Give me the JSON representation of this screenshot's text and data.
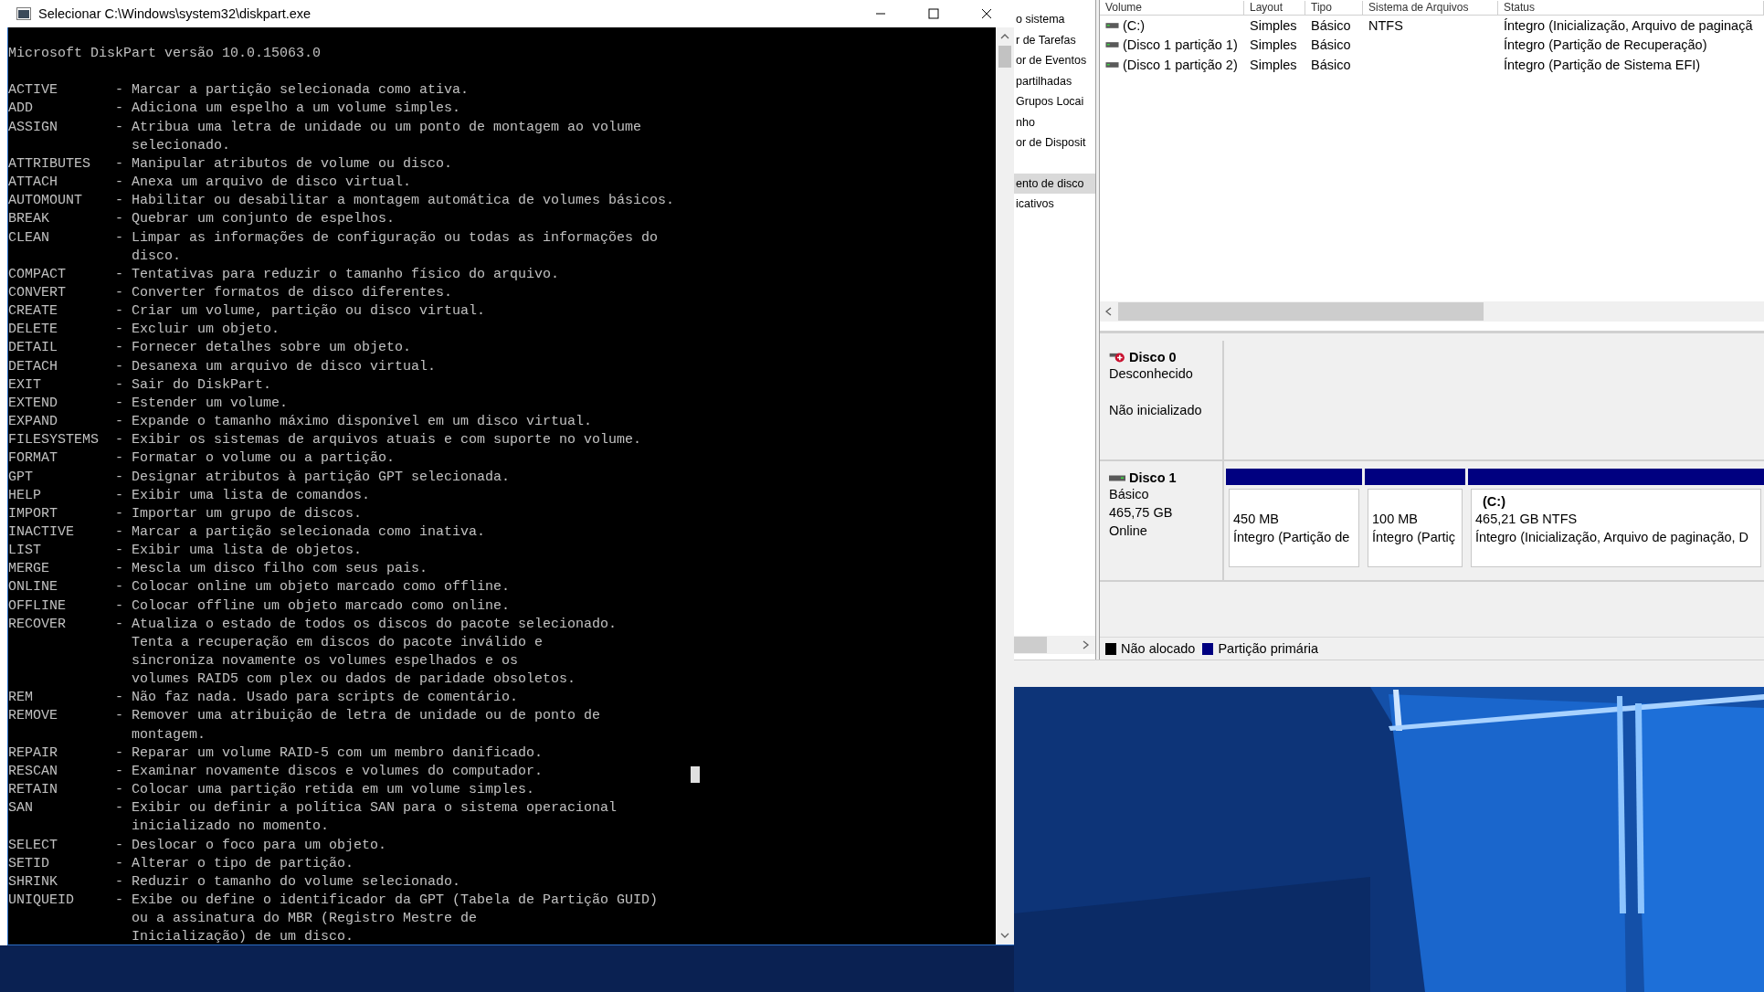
{
  "console": {
    "title": "Selecionar C:\\Windows\\system32\\diskpart.exe",
    "header": "Microsoft DiskPart versão 10.0.15063.0",
    "commands": [
      {
        "name": "ACTIVE",
        "lines": [
          "- Marcar a partição selecionada como ativa."
        ],
        "cursor": false
      },
      {
        "name": "ADD",
        "lines": [
          "- Adiciona um espelho a um volume simples."
        ],
        "cursor": false
      },
      {
        "name": "ASSIGN",
        "lines": [
          "- Atribua uma letra de unidade ou um ponto de montagem ao volume",
          "selecionado."
        ],
        "cursor": false
      },
      {
        "name": "ATTRIBUTES",
        "lines": [
          "- Manipular atributos de volume ou disco."
        ],
        "cursor": false
      },
      {
        "name": "ATTACH",
        "lines": [
          "- Anexa um arquivo de disco virtual."
        ],
        "cursor": false
      },
      {
        "name": "AUTOMOUNT",
        "lines": [
          "- Habilitar ou desabilitar a montagem automática de volumes básicos."
        ],
        "cursor": false
      },
      {
        "name": "BREAK",
        "lines": [
          "- Quebrar um conjunto de espelhos."
        ],
        "cursor": false
      },
      {
        "name": "CLEAN",
        "lines": [
          "- Limpar as informações de configuração ou todas as informações do",
          "disco."
        ],
        "cursor": false
      },
      {
        "name": "COMPACT",
        "lines": [
          "- Tentativas para reduzir o tamanho físico do arquivo."
        ],
        "cursor": false
      },
      {
        "name": "CONVERT",
        "lines": [
          "- Converter formatos de disco diferentes."
        ],
        "cursor": false
      },
      {
        "name": "CREATE",
        "lines": [
          "- Criar um volume, partição ou disco virtual."
        ],
        "cursor": false
      },
      {
        "name": "DELETE",
        "lines": [
          "- Excluir um objeto."
        ],
        "cursor": false
      },
      {
        "name": "DETAIL",
        "lines": [
          "- Fornecer detalhes sobre um objeto."
        ],
        "cursor": false
      },
      {
        "name": "DETACH",
        "lines": [
          "- Desanexa um arquivo de disco virtual."
        ],
        "cursor": false
      },
      {
        "name": "EXIT",
        "lines": [
          "- Sair do DiskPart."
        ],
        "cursor": false
      },
      {
        "name": "EXTEND",
        "lines": [
          "- Estender um volume."
        ],
        "cursor": false
      },
      {
        "name": "EXPAND",
        "lines": [
          "- Expande o tamanho máximo disponível em um disco virtual."
        ],
        "cursor": false
      },
      {
        "name": "FILESYSTEMS",
        "lines": [
          "- Exibir os sistemas de arquivos atuais e com suporte no volume."
        ],
        "cursor": false
      },
      {
        "name": "FORMAT",
        "lines": [
          "- Formatar o volume ou a partição."
        ],
        "cursor": false
      },
      {
        "name": "GPT",
        "lines": [
          "- Designar atributos à partição GPT selecionada."
        ],
        "cursor": false
      },
      {
        "name": "HELP",
        "lines": [
          "- Exibir uma lista de comandos."
        ],
        "cursor": false
      },
      {
        "name": "IMPORT",
        "lines": [
          "- Importar um grupo de discos."
        ],
        "cursor": false
      },
      {
        "name": "INACTIVE",
        "lines": [
          "- Marcar a partição selecionada como inativa."
        ],
        "cursor": false
      },
      {
        "name": "LIST",
        "lines": [
          "- Exibir uma lista de objetos."
        ],
        "cursor": false
      },
      {
        "name": "MERGE",
        "lines": [
          "- Mescla um disco filho com seus pais."
        ],
        "cursor": false
      },
      {
        "name": "ONLINE",
        "lines": [
          "- Colocar online um objeto marcado como offline."
        ],
        "cursor": false
      },
      {
        "name": "OFFLINE",
        "lines": [
          "- Colocar offline um objeto marcado como online."
        ],
        "cursor": false
      },
      {
        "name": "RECOVER",
        "lines": [
          "- Atualiza o estado de todos os discos do pacote selecionado.",
          "Tenta a recuperação em discos do pacote inválido e",
          "sincroniza novamente os volumes espelhados e os",
          "volumes RAID5 com plex ou dados de paridade obsoletos."
        ],
        "cursor": false
      },
      {
        "name": "REM",
        "lines": [
          "- Não faz nada. Usado para scripts de comentário."
        ],
        "cursor": false
      },
      {
        "name": "REMOVE",
        "lines": [
          "- Remover uma atribuição de letra de unidade ou de ponto de",
          "montagem."
        ],
        "cursor": false
      },
      {
        "name": "REPAIR",
        "lines": [
          "- Reparar um volume RAID-5 com um membro danificado."
        ],
        "cursor": false
      },
      {
        "name": "RESCAN",
        "lines": [
          "- Examinar novamente discos e volumes do computador."
        ],
        "cursor": true
      },
      {
        "name": "RETAIN",
        "lines": [
          "- Colocar uma partição retida em um volume simples."
        ],
        "cursor": false
      },
      {
        "name": "SAN",
        "lines": [
          "- Exibir ou definir a política SAN para o sistema operacional",
          "inicializado no momento."
        ],
        "cursor": false
      },
      {
        "name": "SELECT",
        "lines": [
          "- Deslocar o foco para um objeto."
        ],
        "cursor": false
      },
      {
        "name": "SETID",
        "lines": [
          "- Alterar o tipo de partição."
        ],
        "cursor": false
      },
      {
        "name": "SHRINK",
        "lines": [
          "- Reduzir o tamanho do volume selecionado."
        ],
        "cursor": false
      },
      {
        "name": "UNIQUEID",
        "lines": [
          "- Exibe ou define o identificador da GPT (Tabela de Partição GUID)",
          "ou a assinatura do MBR (Registro Mestre de",
          "Inicialização) de um disco."
        ],
        "cursor": false
      }
    ]
  },
  "management": {
    "nav": {
      "items": [
        {
          "label": "o sistema",
          "selected": false
        },
        {
          "label": "r de Tarefas",
          "selected": false
        },
        {
          "label": "or de Eventos",
          "selected": false
        },
        {
          "label": "partilhadas",
          "selected": false
        },
        {
          "label": "Grupos Locai",
          "selected": false
        },
        {
          "label": "nho",
          "selected": false
        },
        {
          "label": "or de Disposit",
          "selected": false
        },
        {
          "label": "ento de disco",
          "selected": true
        },
        {
          "label": "icativos",
          "selected": false
        }
      ]
    },
    "volumes": {
      "columns": [
        "Volume",
        "Layout",
        "Tipo",
        "Sistema de Arquivos",
        "Status"
      ],
      "rows": [
        {
          "cells": [
            "(C:)",
            "Simples",
            "Básico",
            "NTFS",
            "Íntegro (Inicialização, Arquivo de paginaçã"
          ]
        },
        {
          "cells": [
            "(Disco 1 partição 1)",
            "Simples",
            "Básico",
            "",
            "Íntegro (Partição de Recuperação)"
          ]
        },
        {
          "cells": [
            "(Disco 1 partição 2)",
            "Simples",
            "Básico",
            "",
            "Íntegro (Partição de Sistema EFI)"
          ]
        }
      ]
    },
    "disks": [
      {
        "name": "Disco 0",
        "kind": "error",
        "info": [
          "Desconhecido"
        ],
        "status": "Não inicializado"
      },
      {
        "name": "Disco 1",
        "kind": "basic",
        "info": [
          "Básico",
          "465,75 GB",
          "Online"
        ],
        "partitions": [
          {
            "size": "450 MB",
            "status": "Íntegro (Partição de",
            "color": "#000080"
          },
          {
            "size": "100 MB",
            "status": "Íntegro (Partiç",
            "color": "#000080"
          },
          {
            "label": "(C:)",
            "size": "465,21 GB NTFS",
            "status": "Íntegro (Inicialização, Arquivo de paginação, D",
            "color": "#000080"
          }
        ]
      }
    ],
    "legend": [
      {
        "label": "Não alocado",
        "color": "#000000"
      },
      {
        "label": "Partição primária",
        "color": "#000080"
      }
    ]
  }
}
